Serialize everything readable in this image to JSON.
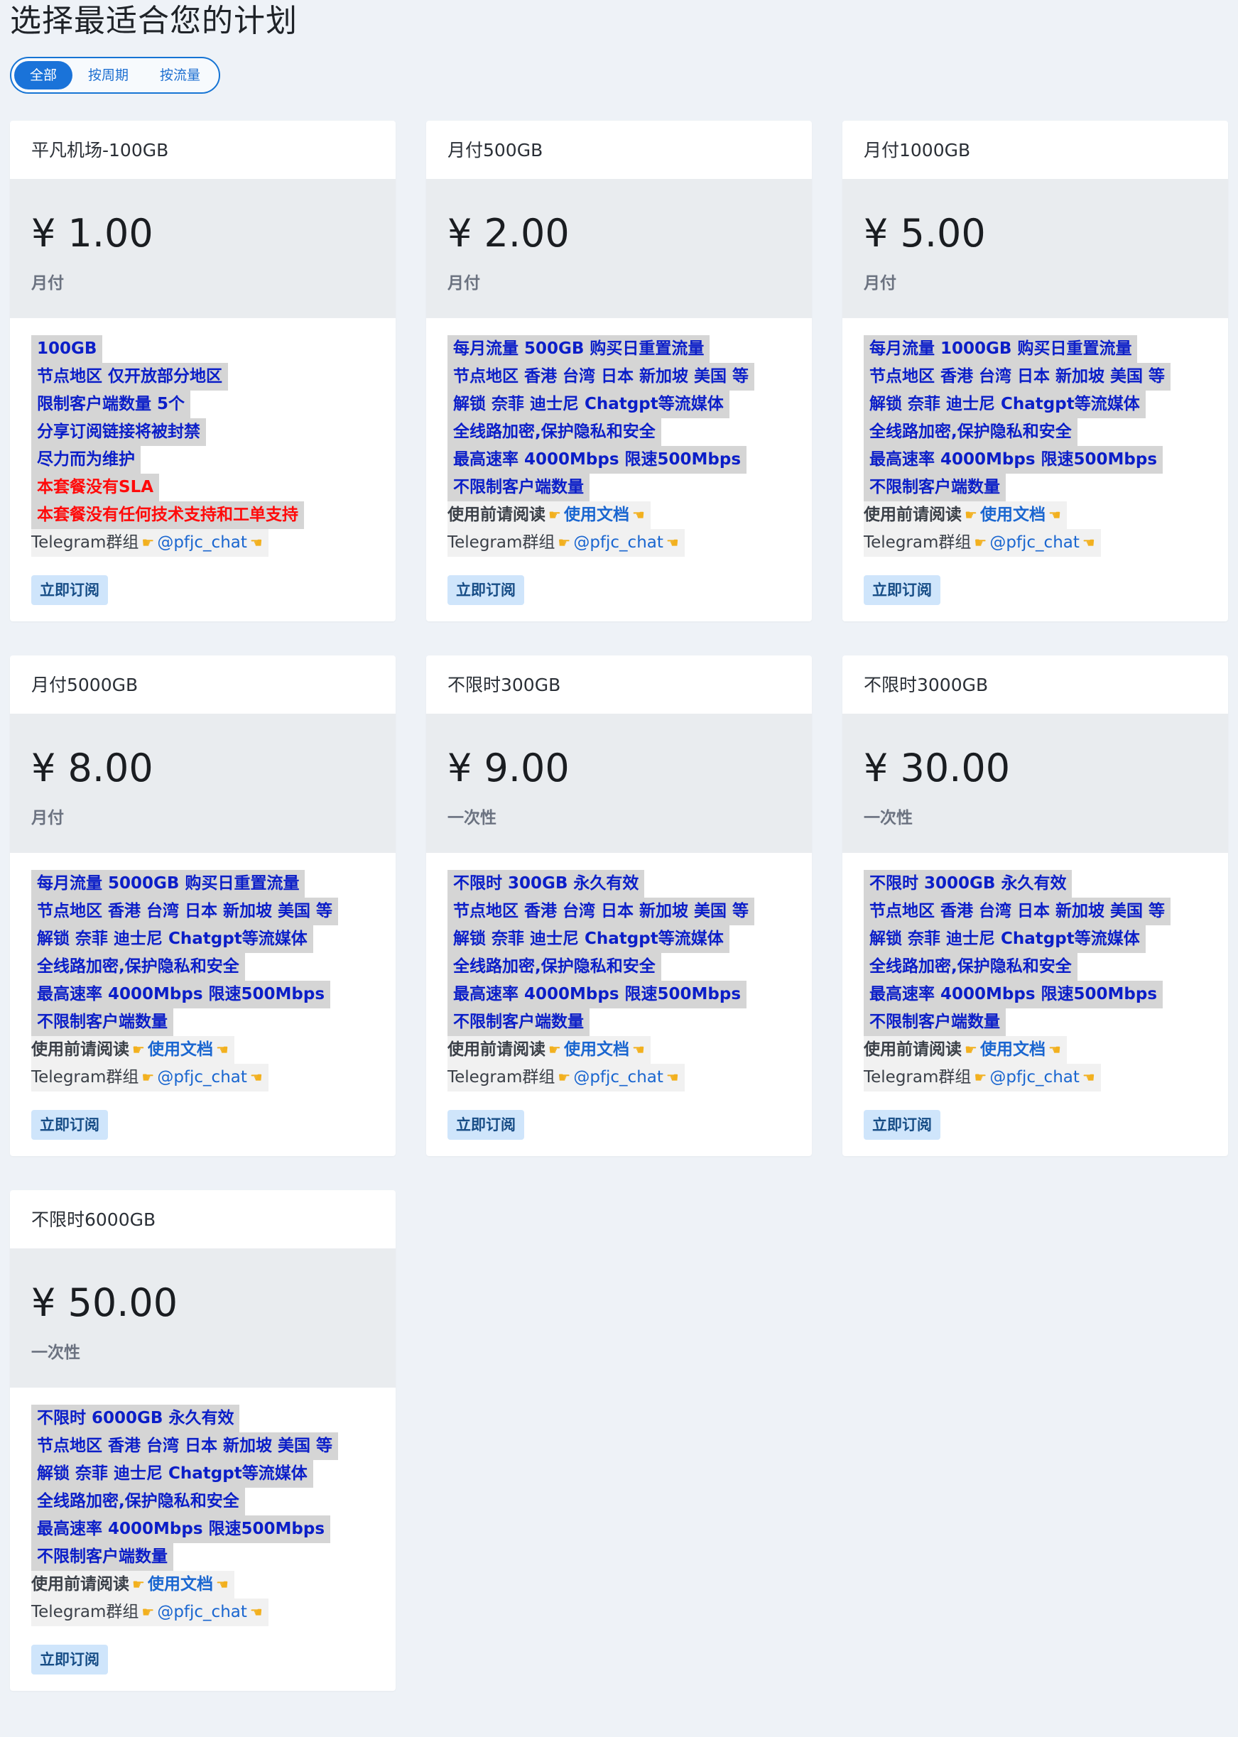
{
  "title": "选择最适合您的计划",
  "filters": [
    {
      "label": "全部",
      "active": true
    },
    {
      "label": "按周期",
      "active": false
    },
    {
      "label": "按流量",
      "active": false
    }
  ],
  "subscribe_label": "立即订阅",
  "doc_prefix": "使用前请阅读",
  "doc_link": "使用文档",
  "telegram_prefix": "Telegram群组",
  "telegram_link": "@pfjc_chat",
  "plans": [
    {
      "name": "平凡机场-100GB",
      "price": "¥ 1.00",
      "period": "月付",
      "features": [
        {
          "text": "100GB",
          "red": false
        },
        {
          "text": "节点地区 仅开放部分地区",
          "red": false
        },
        {
          "text": "限制客户端数量 5个",
          "red": false
        },
        {
          "text": "分享订阅链接将被封禁",
          "red": false
        },
        {
          "text": "尽力而为维护",
          "red": false
        },
        {
          "text": "本套餐没有SLA",
          "red": true
        },
        {
          "text": "本套餐没有任何技术支持和工单支持",
          "red": true
        }
      ],
      "show_doc": false
    },
    {
      "name": "月付500GB",
      "price": "¥ 2.00",
      "period": "月付",
      "features": [
        {
          "text": "每月流量 500GB 购买日重置流量",
          "red": false
        },
        {
          "text": "节点地区 香港 台湾 日本 新加坡 美国 等",
          "red": false
        },
        {
          "text": "解锁 奈菲 迪士尼 Chatgpt等流媒体",
          "red": false
        },
        {
          "text": "全线路加密,保护隐私和安全",
          "red": false
        },
        {
          "text": "最高速率 4000Mbps 限速500Mbps",
          "red": false
        },
        {
          "text": "不限制客户端数量",
          "red": false
        }
      ],
      "show_doc": true
    },
    {
      "name": "月付1000GB",
      "price": "¥ 5.00",
      "period": "月付",
      "features": [
        {
          "text": "每月流量 1000GB 购买日重置流量",
          "red": false
        },
        {
          "text": "节点地区 香港 台湾 日本 新加坡 美国 等",
          "red": false
        },
        {
          "text": "解锁 奈菲 迪士尼 Chatgpt等流媒体",
          "red": false
        },
        {
          "text": "全线路加密,保护隐私和安全",
          "red": false
        },
        {
          "text": "最高速率 4000Mbps 限速500Mbps",
          "red": false
        },
        {
          "text": "不限制客户端数量",
          "red": false
        }
      ],
      "show_doc": true
    },
    {
      "name": "月付5000GB",
      "price": "¥ 8.00",
      "period": "月付",
      "features": [
        {
          "text": "每月流量 5000GB 购买日重置流量",
          "red": false
        },
        {
          "text": "节点地区 香港 台湾 日本 新加坡 美国 等",
          "red": false
        },
        {
          "text": "解锁 奈菲 迪士尼 Chatgpt等流媒体",
          "red": false
        },
        {
          "text": "全线路加密,保护隐私和安全",
          "red": false
        },
        {
          "text": "最高速率 4000Mbps 限速500Mbps",
          "red": false
        },
        {
          "text": "不限制客户端数量",
          "red": false
        }
      ],
      "show_doc": true
    },
    {
      "name": "不限时300GB",
      "price": "¥ 9.00",
      "period": "一次性",
      "features": [
        {
          "text": "不限时 300GB 永久有效",
          "red": false
        },
        {
          "text": "节点地区 香港 台湾 日本 新加坡 美国 等",
          "red": false
        },
        {
          "text": "解锁 奈菲 迪士尼 Chatgpt等流媒体",
          "red": false
        },
        {
          "text": "全线路加密,保护隐私和安全",
          "red": false
        },
        {
          "text": "最高速率 4000Mbps 限速500Mbps",
          "red": false
        },
        {
          "text": "不限制客户端数量",
          "red": false
        }
      ],
      "show_doc": true
    },
    {
      "name": "不限时3000GB",
      "price": "¥ 30.00",
      "period": "一次性",
      "features": [
        {
          "text": "不限时 3000GB 永久有效",
          "red": false
        },
        {
          "text": "节点地区 香港 台湾 日本 新加坡 美国 等",
          "red": false
        },
        {
          "text": "解锁 奈菲 迪士尼 Chatgpt等流媒体",
          "red": false
        },
        {
          "text": "全线路加密,保护隐私和安全",
          "red": false
        },
        {
          "text": "最高速率 4000Mbps 限速500Mbps",
          "red": false
        },
        {
          "text": "不限制客户端数量",
          "red": false
        }
      ],
      "show_doc": true
    },
    {
      "name": "不限时6000GB",
      "price": "¥ 50.00",
      "period": "一次性",
      "features": [
        {
          "text": "不限时 6000GB 永久有效",
          "red": false
        },
        {
          "text": "节点地区 香港 台湾 日本 新加坡 美国 等",
          "red": false
        },
        {
          "text": "解锁 奈菲 迪士尼 Chatgpt等流媒体",
          "red": false
        },
        {
          "text": "全线路加密,保护隐私和安全",
          "red": false
        },
        {
          "text": "最高速率 4000Mbps 限速500Mbps",
          "red": false
        },
        {
          "text": "不限制客户端数量",
          "red": false
        }
      ],
      "show_doc": true
    }
  ]
}
